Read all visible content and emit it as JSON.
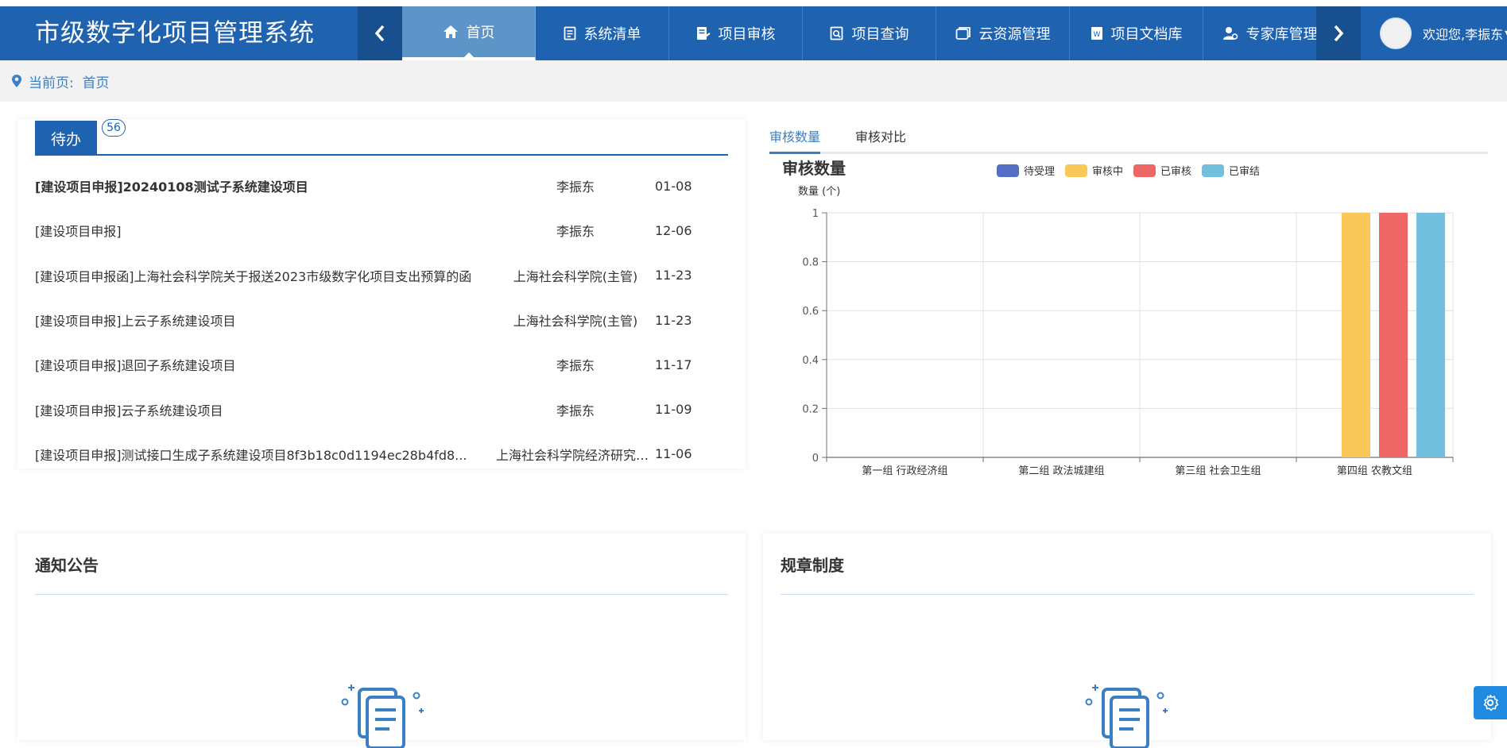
{
  "app": {
    "title": "市级数字化项目管理系统"
  },
  "nav": {
    "items": [
      {
        "label": "首页",
        "icon": "home-icon",
        "active": true
      },
      {
        "label": "系统清单",
        "icon": "list-icon"
      },
      {
        "label": "项目审核",
        "icon": "review-icon"
      },
      {
        "label": "项目查询",
        "icon": "query-icon"
      },
      {
        "label": "云资源管理",
        "icon": "cloud-resource-icon"
      },
      {
        "label": "项目文档库",
        "icon": "word-doc-icon"
      },
      {
        "label": "专家库管理",
        "icon": "expert-icon"
      }
    ]
  },
  "user": {
    "greeting": "欢迎您,李振东"
  },
  "breadcrumb": {
    "text": "当前页:  首页"
  },
  "todo": {
    "tab_label": "待办",
    "badge": "56",
    "items": [
      {
        "title": "[建设项目申报]20240108测试子系统建设项目",
        "who": "李振东",
        "date": "01-08"
      },
      {
        "title": "[建设项目申报]",
        "who": "李振东",
        "date": "12-06"
      },
      {
        "title": "[建设项目申报函]上海社会科学院关于报送2023市级数字化项目支出预算的函",
        "who": "上海社会科学院(主管)",
        "date": "11-23"
      },
      {
        "title": "[建设项目申报]上云子系统建设项目",
        "who": "上海社会科学院(主管)",
        "date": "11-23"
      },
      {
        "title": "[建设项目申报]退回子系统建设项目",
        "who": "李振东",
        "date": "11-17"
      },
      {
        "title": "[建设项目申报]云子系统建设项目",
        "who": "李振东",
        "date": "11-09"
      },
      {
        "title": "[建设项目申报]测试接口生成子系统建设项目8f3b18c0d1194ec28b4fd8...",
        "who": "上海社会科学院经济研究所...",
        "date": "11-06"
      }
    ]
  },
  "chart_tabs": [
    {
      "label": "审核数量",
      "active": true
    },
    {
      "label": "审核对比"
    }
  ],
  "chart_data": {
    "type": "bar",
    "title": "审核数量",
    "ylabel": "数量 (个)",
    "xlabel": "",
    "categories": [
      "第一组 行政经济组",
      "第二组 政法城建组",
      "第三组 社会卫生组",
      "第四组 农教文组"
    ],
    "series": [
      {
        "name": "待受理",
        "color": "#5470c6",
        "values": [
          0,
          0,
          0,
          0
        ]
      },
      {
        "name": "审核中",
        "color": "#f9c859",
        "values": [
          0,
          0,
          0,
          1
        ]
      },
      {
        "name": "已审核",
        "color": "#ee6666",
        "values": [
          0,
          0,
          0,
          1
        ]
      },
      {
        "name": "已审结",
        "color": "#73c0de",
        "values": [
          0,
          0,
          0,
          1
        ]
      }
    ],
    "ylim": [
      0,
      1
    ],
    "yticks": [
      "0",
      "0.2",
      "0.4",
      "0.6",
      "0.8",
      "1"
    ],
    "legend": "top",
    "grid": true
  },
  "notice": {
    "title": "通知公告"
  },
  "rules": {
    "title": "规章制度"
  },
  "colors": {
    "primary": "#1f62b0",
    "active_nav": "#5e95c9",
    "link": "#3b7fc4"
  }
}
